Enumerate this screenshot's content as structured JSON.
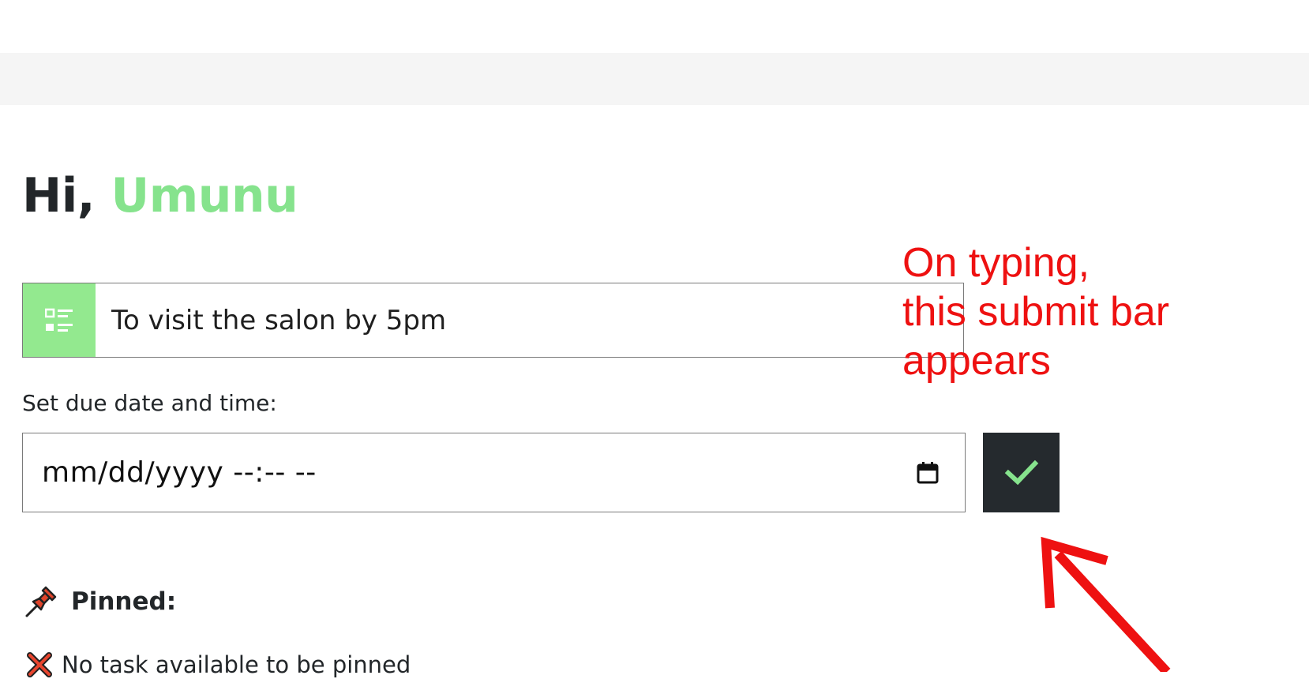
{
  "greeting": {
    "prefix": "Hi,",
    "name": "Umunu"
  },
  "task_input": {
    "value": "To visit the salon by 5pm",
    "icon": "task-list-icon"
  },
  "due": {
    "label": "Set due date and time:",
    "placeholder": "mm/dd/yyyy --:-- --",
    "icon": "calendar-icon"
  },
  "submit": {
    "icon": "checkmark-icon"
  },
  "annotation": {
    "lines": [
      "On typing,",
      "this submit bar",
      "appears"
    ]
  },
  "pinned": {
    "heading": "Pinned:",
    "icon": "pushpin-icon",
    "empty_message": "No task available to be pinned",
    "empty_icon": "cross-mark-icon"
  },
  "colors": {
    "accent_green": "#86e38d",
    "icon_box_green": "#93e98f",
    "dark": "#252a2e",
    "annotation_red": "#ee1111",
    "band_gray": "#f5f5f5"
  }
}
